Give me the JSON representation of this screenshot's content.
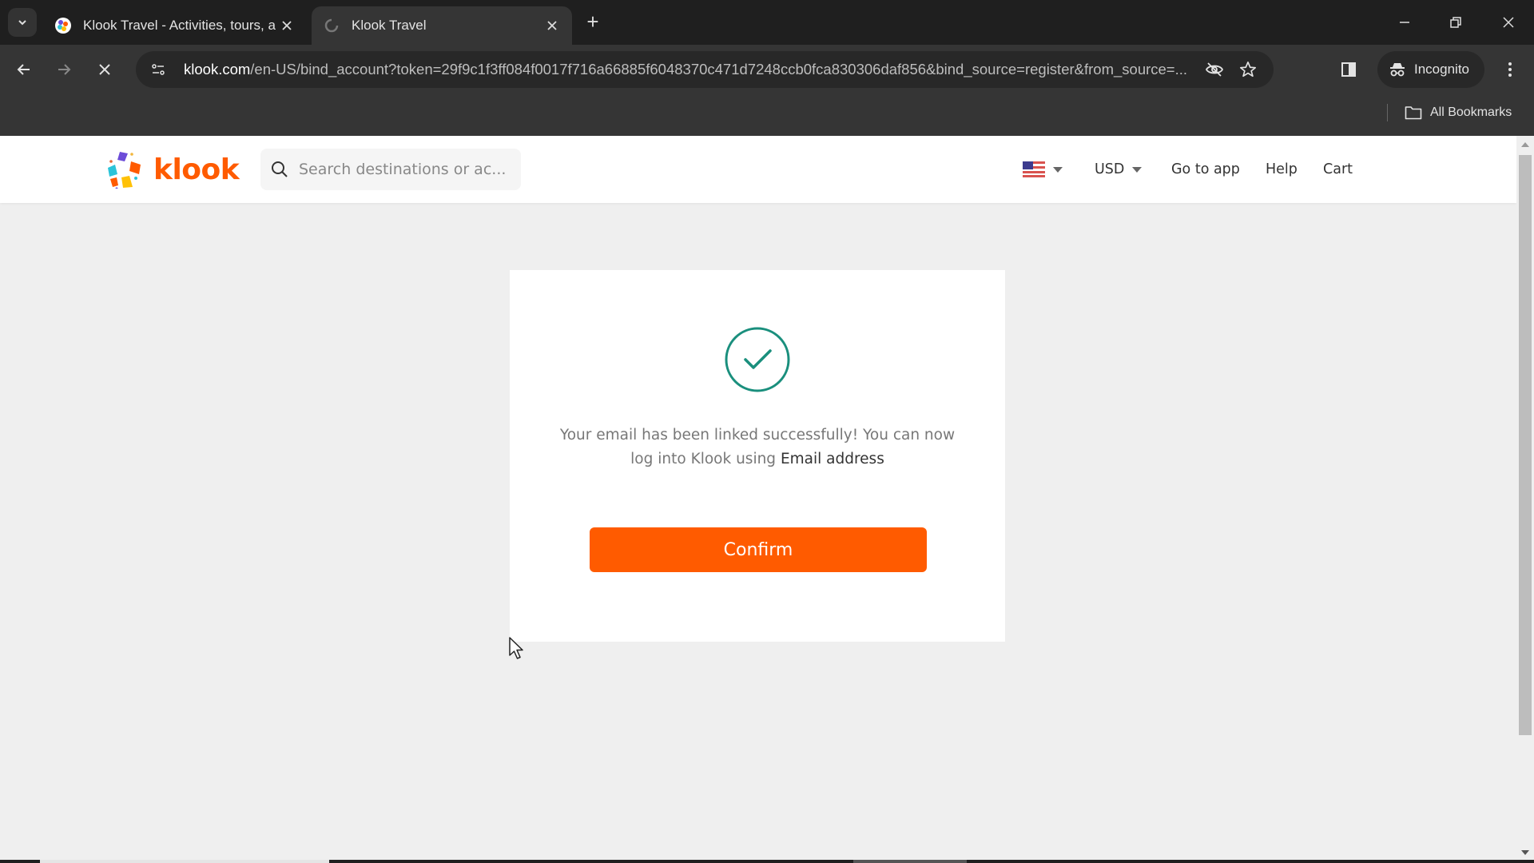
{
  "browser": {
    "tabs": [
      {
        "title": "Klook Travel - Activities, tours, a",
        "active": false,
        "favicon": "klook-favicon-icon"
      },
      {
        "title": "Klook Travel",
        "active": true,
        "favicon": "loading-favicon-icon"
      }
    ],
    "new_tab_label": "+",
    "url_host": "klook.com",
    "url_rest": "/en-US/bind_account?token=29f9c1f3ff084f0017f716a66885f6048370c471d7248ccb0fca830306daf856&bind_source=register&from_source=...",
    "incognito_label": "Incognito",
    "all_bookmarks_label": "All Bookmarks",
    "icons": {
      "back": "arrow-left-icon",
      "forward": "arrow-right-icon",
      "stop": "close-icon",
      "site_info": "tune-icon",
      "tracking": "eye-off-icon",
      "bookmark": "star-icon",
      "side_panel": "side-panel-icon",
      "menu": "kebab-menu-icon",
      "folder": "folder-icon"
    }
  },
  "site": {
    "brand": "klook",
    "brand_color": "#ff5b00",
    "search": {
      "placeholder": "Search destinations or ac...",
      "value": ""
    },
    "nav": {
      "language_flag": "us-flag-icon",
      "currency": "USD",
      "go_to_app": "Go to app",
      "help": "Help",
      "cart": "Cart"
    }
  },
  "dialog": {
    "status_icon": "check-circle-icon",
    "status_color": "#1a8f7d",
    "message_prefix": "Your email has been linked successfully! You can now log into Klook using ",
    "message_emphasis": "Email address",
    "confirm_label": "Confirm"
  }
}
